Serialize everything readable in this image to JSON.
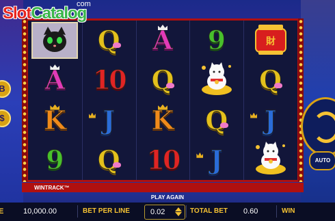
{
  "watermark": {
    "part1": "Slot",
    "part2": "Catalog",
    "suffix": "com"
  },
  "side_buttons": [
    "$",
    "B"
  ],
  "reels": [
    [
      {
        "t": "WILD-CAT",
        "c": "wild"
      },
      {
        "t": "Q",
        "c": "q"
      },
      {
        "t": "A",
        "c": "a-sym"
      },
      {
        "t": "9",
        "c": "n9"
      },
      {
        "t": "LANTERN",
        "c": "lantern"
      }
    ],
    [
      {
        "t": "A",
        "c": "a-sym"
      },
      {
        "t": "10",
        "c": "n10"
      },
      {
        "t": "Q",
        "c": "q"
      },
      {
        "t": "LUCKY-CAT",
        "c": "cat"
      },
      {
        "t": "Q",
        "c": "q"
      }
    ],
    [
      {
        "t": "K",
        "c": "k"
      },
      {
        "t": "J",
        "c": "j"
      },
      {
        "t": "K",
        "c": "k"
      },
      {
        "t": "Q",
        "c": "q"
      },
      {
        "t": "J",
        "c": "j"
      }
    ],
    [
      {
        "t": "9",
        "c": "n9"
      },
      {
        "t": "Q",
        "c": "q"
      },
      {
        "t": "10",
        "c": "n10"
      },
      {
        "t": "J",
        "c": "j"
      },
      {
        "t": "LUCKY-CAT",
        "c": "cat"
      }
    ]
  ],
  "wintrack_label": "WINTRACK™",
  "play_again": "PLAY AGAIN",
  "bottom": {
    "balance": "10,000.00",
    "bet_per_line_label": "BET PER LINE",
    "bet_per_line_value": "0.02",
    "total_bet_label": "TOTAL BET",
    "total_bet_value": "0.60",
    "win_label": "WIN",
    "balance_prefix": "E"
  },
  "auto_label": "AUTO",
  "colors": {
    "frame": "#b01010",
    "accent": "#f5c233",
    "bg": "#12163a"
  }
}
